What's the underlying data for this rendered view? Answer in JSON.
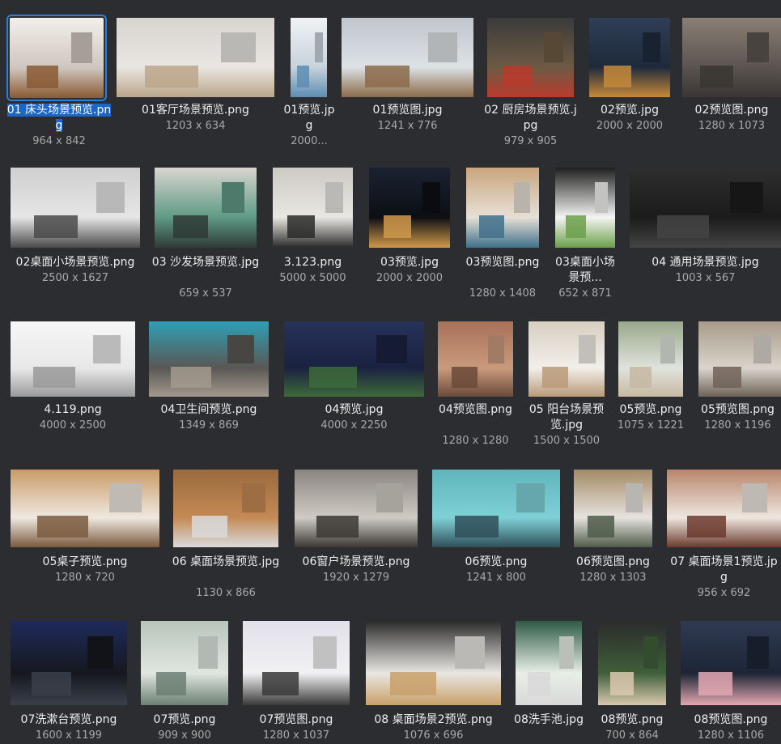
{
  "files": [
    {
      "name": "01 床头场景预览.png",
      "dims": "964 x 842",
      "selected": true,
      "colors": [
        "#cfc7bf",
        "#f2efea",
        "#8a5a34"
      ]
    },
    {
      "name": "01客厅场景预览.png",
      "dims": "1203 x 634",
      "colors": [
        "#e9e6e1",
        "#d8d5d1",
        "#bba68a"
      ]
    },
    {
      "name": "01预览.jpg",
      "dims": "2000...",
      "colors": [
        "#c8d3dc",
        "#f0f3f5",
        "#5c8db3"
      ]
    },
    {
      "name": "01预览图.jpg",
      "dims": "1241 x 776",
      "colors": [
        "#dde2e6",
        "#bfc6cc",
        "#8b6a49"
      ]
    },
    {
      "name": "02 厨房场景预览.jpg",
      "dims": "979 x 905",
      "colors": [
        "#6d5a44",
        "#3b3b3b",
        "#b93b2c"
      ]
    },
    {
      "name": "02预览.jpg",
      "dims": "2000 x 2000",
      "colors": [
        "#1e2a3c",
        "#2f3e55",
        "#c68a3a"
      ]
    },
    {
      "name": "02预览图.png",
      "dims": "1280 x 1073",
      "colors": [
        "#5b5450",
        "#8a7f75",
        "#3a3633"
      ]
    },
    {
      "name": "02桌面小场景预览.png",
      "dims": "2500 x 1627",
      "colors": [
        "#e6e6e6",
        "#cfcfcf",
        "#4a4a4a"
      ]
    },
    {
      "name": "03 沙发场景预览.jpg",
      "dims": "659 x 537",
      "colors": [
        "#5f9a86",
        "#d9d6cf",
        "#2f3a36"
      ]
    },
    {
      "name": "3.123.png",
      "dims": "5000 x 5000",
      "colors": [
        "#e9e7e2",
        "#cdcac4",
        "#2a2a2a"
      ]
    },
    {
      "name": "03预览.jpg",
      "dims": "2000 x 2000",
      "colors": [
        "#0c0f14",
        "#1a2230",
        "#d19a4a"
      ]
    },
    {
      "name": "03预览图.png",
      "dims": "1280 x 1408",
      "colors": [
        "#e7e0d6",
        "#c9a57d",
        "#3f6f8a"
      ]
    },
    {
      "name": "03桌面小场景预...",
      "dims": "652 x 871",
      "colors": [
        "#f4f4f2",
        "#1f1f1f",
        "#6aa04a"
      ]
    },
    {
      "name": "04 通用场景预览.jpg",
      "dims": "1003 x 567",
      "colors": [
        "#1b1b1b",
        "#2e2e2e",
        "#444444"
      ]
    },
    {
      "name": "4.119.png",
      "dims": "4000 x 2500",
      "colors": [
        "#e8e8e8",
        "#f6f6f6",
        "#9a9a9a"
      ]
    },
    {
      "name": "04卫生间预览.png",
      "dims": "1349 x 869",
      "colors": [
        "#5a5754",
        "#2f9fb5",
        "#a39a8e"
      ]
    },
    {
      "name": "04预览.jpg",
      "dims": "4000 x 2250",
      "colors": [
        "#1a2240",
        "#27325a",
        "#3d6a3a"
      ]
    },
    {
      "name": "04预览图.png",
      "dims": "1280 x 1280",
      "colors": [
        "#c99a7c",
        "#a8715a",
        "#6b4a3a"
      ]
    },
    {
      "name": "05 阳台场景预览.jpg",
      "dims": "1500 x 1500",
      "colors": [
        "#f2efea",
        "#d9cfc2",
        "#b89a78"
      ]
    },
    {
      "name": "05预览.png",
      "dims": "1075 x 1221",
      "colors": [
        "#dfe3dc",
        "#9aa88a",
        "#c7b9a2"
      ]
    },
    {
      "name": "05预览图.png",
      "dims": "1280 x 1196",
      "colors": [
        "#d9d4cc",
        "#a89a8a",
        "#6e6258"
      ]
    },
    {
      "name": "05桌子预览.png",
      "dims": "1280 x 720",
      "colors": [
        "#efe9e1",
        "#c99b66",
        "#7a5a3e"
      ]
    },
    {
      "name": "06 桌面场景预览.jpg",
      "dims": "1130 x 866",
      "colors": [
        "#c48a55",
        "#9a6a3d",
        "#d9dadc"
      ]
    },
    {
      "name": "06窗户场景预览.png",
      "dims": "1920 x 1279",
      "colors": [
        "#cfcac3",
        "#8a8580",
        "#3b3835"
      ]
    },
    {
      "name": "06预览.png",
      "dims": "1241 x 800",
      "colors": [
        "#7fd1d6",
        "#5fb5bb",
        "#2f4f5a"
      ]
    },
    {
      "name": "06预览图.png",
      "dims": "1280 x 1303",
      "colors": [
        "#e6e3de",
        "#a48a66",
        "#4f5b4a"
      ]
    },
    {
      "name": "07 桌面场景1预览.jpg",
      "dims": "956 x 692",
      "colors": [
        "#eee7df",
        "#b8856b",
        "#6b3b2f"
      ]
    },
    {
      "name": "07洗漱台预览.png",
      "dims": "1600 x 1199",
      "colors": [
        "#15181f",
        "#1f2a5a",
        "#3a3f4a"
      ]
    },
    {
      "name": "07预览.png",
      "dims": "909 x 900",
      "colors": [
        "#dfe6e0",
        "#b9c6bc",
        "#6c7f73"
      ]
    },
    {
      "name": "07预览图.png",
      "dims": "1280 x 1037",
      "colors": [
        "#f1f1f3",
        "#e2e0ea",
        "#3a3a3a"
      ]
    },
    {
      "name": "08 桌面场景2预览.png",
      "dims": "1076 x 696",
      "colors": [
        "#e9e7e3",
        "#2b2b2b",
        "#c8a06a"
      ]
    },
    {
      "name": "08洗手池.jpg",
      "dims": "",
      "colors": [
        "#e8efe7",
        "#2f5a45",
        "#d8d8d8"
      ]
    },
    {
      "name": "08预览.png",
      "dims": "700 x 864",
      "colors": [
        "#3f5f3a",
        "#2b2b2b",
        "#d9c9b0"
      ]
    },
    {
      "name": "08预览图.png",
      "dims": "1280 x 1106",
      "colors": [
        "#1d2536",
        "#2f3a52",
        "#e3a8b1"
      ]
    }
  ]
}
